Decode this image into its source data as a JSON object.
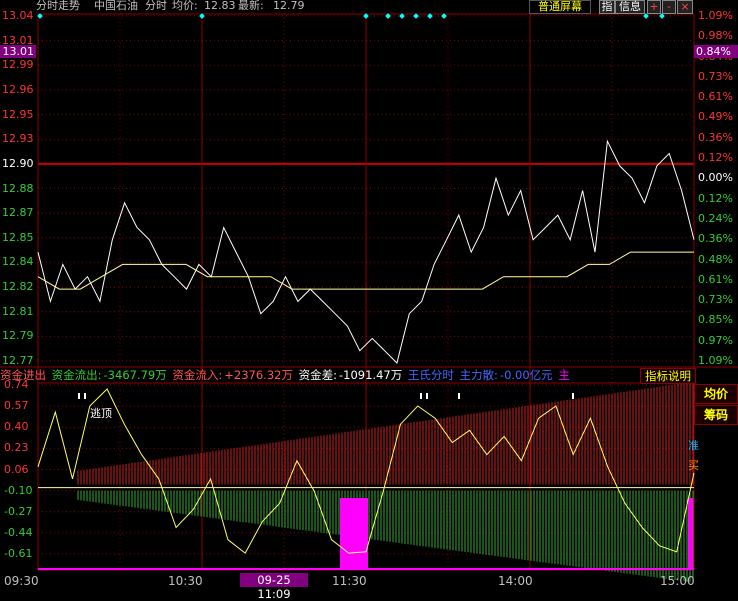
{
  "topbar": {
    "title": "分时走势",
    "stock_name": "中国石油",
    "period": "分时",
    "avg_label": "均价:",
    "avg_value": "12.83",
    "last_label": "最新:",
    "last_value": "12.79",
    "mode_button": "普通屏幕",
    "btn_zhi": "指",
    "btn_info": "信息",
    "btn_plus": "+",
    "btn_minus": "-",
    "btn_close": "×"
  },
  "price_axis": {
    "left": [
      "13.04",
      "13.01",
      "12.99",
      "12.96",
      "12.95",
      "12.93",
      "12.90",
      "12.88",
      "12.87",
      "12.85",
      "12.84",
      "12.82",
      "12.81",
      "12.79",
      "12.77"
    ],
    "right": [
      "1.09%",
      "0.98%",
      "0.84%",
      "0.73%",
      "0.61%",
      "0.49%",
      "0.36%",
      "0.12%",
      "0.00%",
      "0.12%",
      "0.24%",
      "0.36%",
      "0.48%",
      "0.61%",
      "0.73%",
      "0.85%",
      "0.97%",
      "1.09%"
    ],
    "current_price": "13.01",
    "current_pct": "0.84%"
  },
  "infobar": {
    "label1": "资金进出",
    "label2": "资金流出:",
    "value2": "-3467.79万",
    "label3": "资金流入:",
    "value3": "+2376.32万",
    "label4": "资金差:",
    "value4": "-1091.47万",
    "label5": "王氏分时",
    "label6": "主力散:",
    "value6": "-0.00亿元",
    "label7": "主",
    "indicator_button": "指标说明"
  },
  "side_buttons": {
    "avg_button": "均价",
    "chip_button": "筹码"
  },
  "indicator_axis": [
    "0.74",
    "0.57",
    "0.40",
    "0.23",
    "0.06",
    "-0.10",
    "-0.27",
    "-0.44",
    "-0.61"
  ],
  "annotations": {
    "escape_top": "逃顶",
    "side_text_a": "准",
    "side_text_b": "买"
  },
  "time_axis": {
    "labels": [
      "09:30",
      "10:30",
      "11:30",
      "14:00",
      "15:00"
    ],
    "cursor": "09-25 11:09"
  },
  "colors": {
    "price_line": "#ffffff",
    "avg_line": "#ffff99",
    "up_bar": "#cc2222",
    "down_bar": "#33aa33",
    "magenta": "#ff00ff",
    "grid_red": "#8b0000",
    "axis_up": "#ff3333",
    "axis_down": "#33cc33"
  },
  "chart_data": {
    "type": "line",
    "title": "分时走势 中国石油",
    "price_series": [
      12.85,
      12.81,
      12.84,
      12.82,
      12.83,
      12.81,
      12.86,
      12.89,
      12.87,
      12.86,
      12.84,
      12.83,
      12.82,
      12.84,
      12.83,
      12.87,
      12.85,
      12.83,
      12.8,
      12.81,
      12.83,
      12.81,
      12.82,
      12.81,
      12.8,
      12.79,
      12.77,
      12.78,
      12.77,
      12.76,
      12.8,
      12.81,
      12.84,
      12.86,
      12.88,
      12.85,
      12.87,
      12.91,
      12.88,
      12.9,
      12.86,
      12.87,
      12.88,
      12.86,
      12.9,
      12.85,
      12.94,
      12.92,
      12.91,
      12.89,
      12.92,
      12.93,
      12.9,
      12.86
    ],
    "avg_series": [
      12.83,
      12.82,
      12.82,
      12.83,
      12.84,
      12.84,
      12.84,
      12.84,
      12.83,
      12.83,
      12.83,
      12.83,
      12.82,
      12.82,
      12.82,
      12.82,
      12.82,
      12.82,
      12.82,
      12.82,
      12.82,
      12.82,
      12.83,
      12.83,
      12.83,
      12.83,
      12.84,
      12.84,
      12.85,
      12.85,
      12.85,
      12.85
    ],
    "indicator_series": [
      0.1,
      0.55,
      0.0,
      0.6,
      0.74,
      0.45,
      0.2,
      0.0,
      -0.4,
      -0.25,
      0.0,
      -0.5,
      -0.61,
      -0.35,
      -0.2,
      0.15,
      -0.1,
      -0.5,
      -0.61,
      -0.6,
      -0.1,
      0.45,
      0.6,
      0.5,
      0.3,
      0.4,
      0.2,
      0.35,
      0.15,
      0.5,
      0.6,
      0.2,
      0.5,
      0.1,
      -0.2,
      -0.4,
      -0.55,
      -0.6,
      0.05
    ],
    "ylim_price": [
      12.76,
      13.04
    ],
    "ylim_indicator": [
      -0.7,
      0.74
    ]
  }
}
